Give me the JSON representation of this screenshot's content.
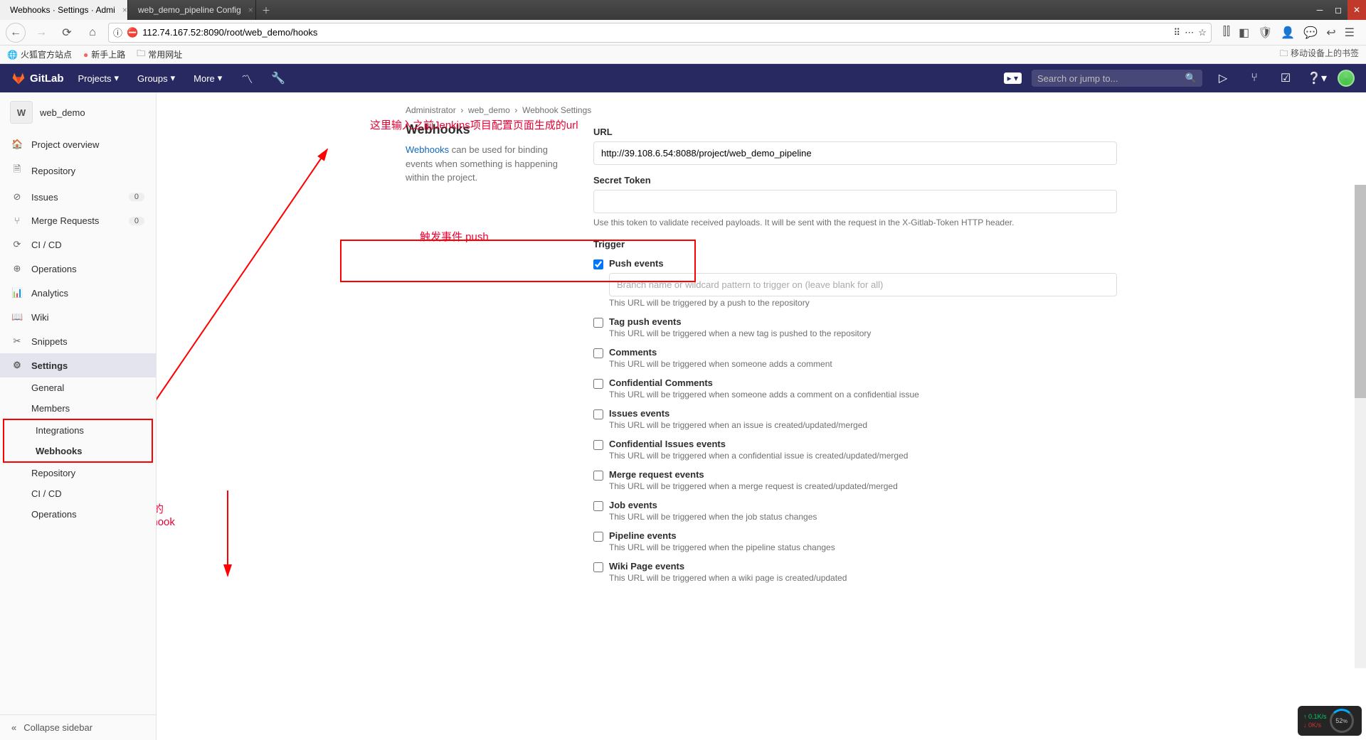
{
  "browser": {
    "tabs": [
      {
        "title": "Webhooks · Settings · Admi",
        "favicon_color": "#e24329"
      },
      {
        "title": "web_demo_pipeline Config",
        "favicon_color": "#d33833"
      }
    ],
    "url": "112.74.167.52:8090/root/web_demo/hooks",
    "bookmarks": [
      "火狐官方站点",
      "新手上路",
      "常用网址"
    ],
    "bookmark_right": "移动设备上的书签"
  },
  "gitlab": {
    "brand": "GitLab",
    "menus": [
      "Projects",
      "Groups",
      "More"
    ],
    "search_placeholder": "Search or jump to...",
    "project_initial": "W",
    "project_name": "web_demo",
    "sidebar": [
      {
        "icon": "🏠",
        "label": "Project overview"
      },
      {
        "icon": "🗎",
        "label": "Repository"
      },
      {
        "icon": "⊘",
        "label": "Issues",
        "count": "0"
      },
      {
        "icon": "⑂",
        "label": "Merge Requests",
        "count": "0"
      },
      {
        "icon": "⟳",
        "label": "CI / CD"
      },
      {
        "icon": "⊕",
        "label": "Operations"
      },
      {
        "icon": "📊",
        "label": "Analytics"
      },
      {
        "icon": "📖",
        "label": "Wiki"
      },
      {
        "icon": "✂",
        "label": "Snippets"
      },
      {
        "icon": "⚙",
        "label": "Settings",
        "active": true
      }
    ],
    "settings_sub": [
      "General",
      "Members",
      "Integrations",
      "Webhooks",
      "Repository",
      "CI / CD",
      "Operations"
    ],
    "collapse_label": "Collapse sidebar",
    "breadcrumb": [
      "Administrator",
      "web_demo",
      "Webhook Settings"
    ]
  },
  "page": {
    "title": "Webhooks",
    "desc_prefix": "Webhooks",
    "desc_rest": " can be used for binding events when something is happening within the project.",
    "url_label": "URL",
    "url_value": "http://39.108.6.54:8088/project/web_demo_pipeline",
    "secret_label": "Secret Token",
    "secret_help": "Use this token to validate received payloads. It will be sent with the request in the X-Gitlab-Token HTTP header.",
    "trigger_label": "Trigger",
    "branch_placeholder": "Branch name or wildcard pattern to trigger on (leave blank for all)",
    "push_help": "This URL will be triggered by a push to the repository",
    "triggers": [
      {
        "title": "Push events",
        "checked": true,
        "has_branch_input": true,
        "desc": "This URL will be triggered by a push to the repository"
      },
      {
        "title": "Tag push events",
        "desc": "This URL will be triggered when a new tag is pushed to the repository"
      },
      {
        "title": "Comments",
        "desc": "This URL will be triggered when someone adds a comment"
      },
      {
        "title": "Confidential Comments",
        "desc": "This URL will be triggered when someone adds a comment on a confidential issue"
      },
      {
        "title": "Issues events",
        "desc": "This URL will be triggered when an issue is created/updated/merged"
      },
      {
        "title": "Confidential Issues events",
        "desc": "This URL will be triggered when a confidential issue is created/updated/merged"
      },
      {
        "title": "Merge request events",
        "desc": "This URL will be triggered when a merge request is created/updated/merged"
      },
      {
        "title": "Job events",
        "desc": "This URL will be triggered when the job status changes"
      },
      {
        "title": "Pipeline events",
        "desc": "This URL will be triggered when the pipeline status changes"
      },
      {
        "title": "Wiki Page events",
        "desc": "This URL will be triggered when a wiki page is created/updated"
      }
    ]
  },
  "annotations": {
    "url_hint": "这里输入之前Jenkins项目配置页面生成的url",
    "trigger_hint": "触发事件  push",
    "add_hint1": "点击下方的",
    "add_hint2": "Add webhook"
  },
  "netspeed": {
    "up": "0.1K/s",
    "down": "0K/s",
    "pct": "52"
  }
}
